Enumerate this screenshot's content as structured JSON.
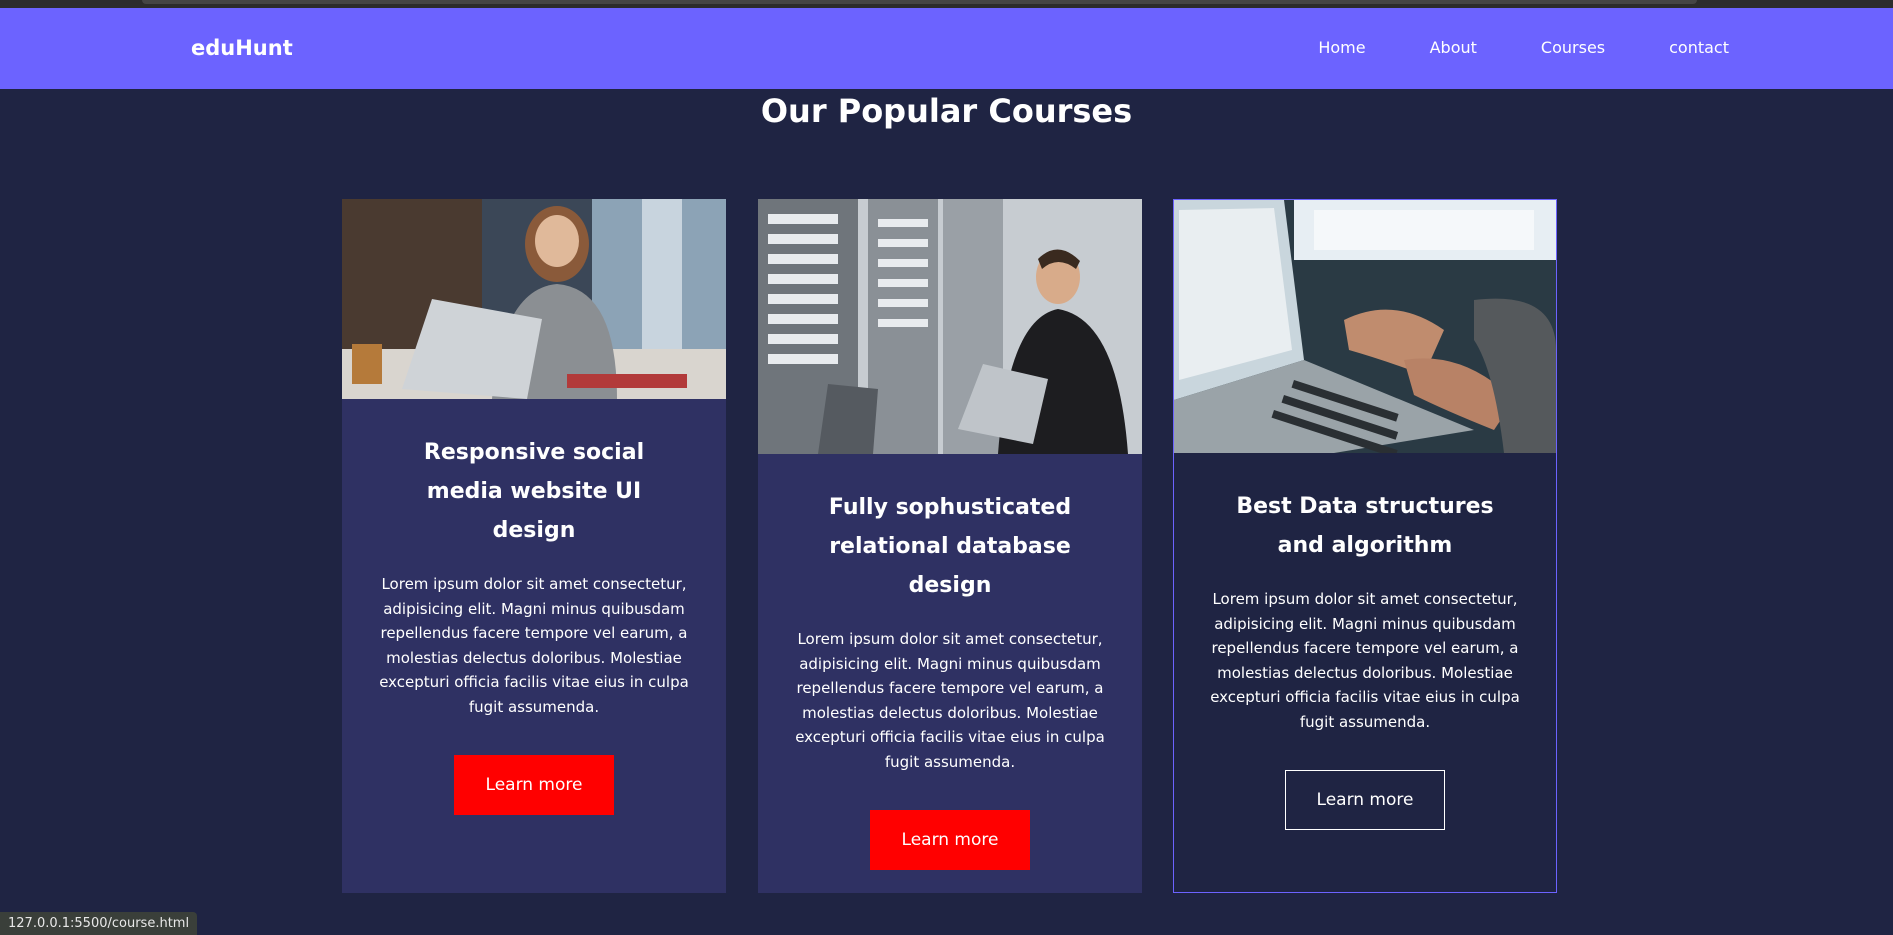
{
  "navbar": {
    "logo": "eduHunt",
    "links": [
      "Home",
      "About",
      "Courses",
      "contact"
    ],
    "color": "#6c63ff"
  },
  "section": {
    "title": "Our Popular Courses"
  },
  "cards": [
    {
      "title": "Responsive social media website UI design",
      "text": "Lorem ipsum dolor sit amet consectetur, adipisicing elit. Magni minus quibusdam repellendus facere tempore vel earum, a molestias delectus doloribus. Molestiae excepturi officia facilis vitae eius in culpa fugit assumenda.",
      "button": "Learn more",
      "image": "woman-laptop-photo"
    },
    {
      "title": "Fully sophusticated relational database design",
      "text": "Lorem ipsum dolor sit amet consectetur, adipisicing elit. Magni minus quibusdam repellendus facere tempore vel earum, a molestias delectus doloribus. Molestiae excepturi officia facilis vitae eius in culpa fugit assumenda.",
      "button": "Learn more",
      "image": "server-room-photo"
    },
    {
      "title": "Best Data structures and algorithm",
      "text": "Lorem ipsum dolor sit amet consectetur, adipisicing elit. Magni minus quibusdam repellendus facere tempore vel earum, a molestias delectus doloribus. Molestiae excepturi officia facilis vitae eius in culpa fugit assumenda.",
      "button": "Learn more",
      "image": "typing-laptop-photo"
    }
  ],
  "status_bar": {
    "url": "127.0.0.1:5500/course.html"
  },
  "colors": {
    "background": "#1f2443",
    "card": "#2f3163",
    "button": "#ff0000"
  }
}
